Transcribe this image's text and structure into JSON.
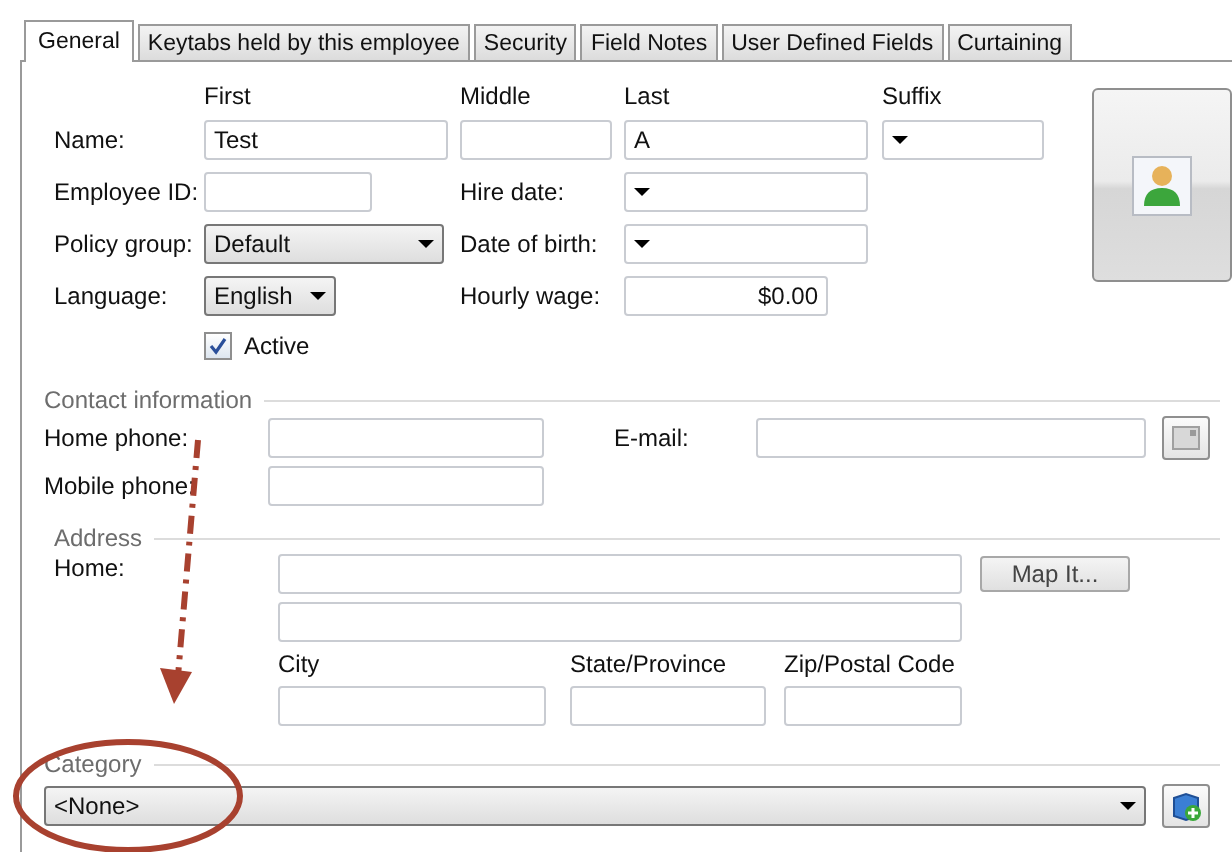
{
  "tabs": [
    {
      "label": "General",
      "selected": true
    },
    {
      "label": "Keytabs held by this employee",
      "selected": false
    },
    {
      "label": "Security",
      "selected": false
    },
    {
      "label": "Field Notes",
      "selected": false
    },
    {
      "label": "User Defined Fields",
      "selected": false
    },
    {
      "label": "Curtaining",
      "selected": false
    }
  ],
  "name_columns": [
    "First",
    "Middle",
    "Last",
    "Suffix"
  ],
  "name": {
    "label": "Name:",
    "first": "Test",
    "last": "A"
  },
  "employee_id_label": "Employee ID:",
  "hire_date_label": "Hire date:",
  "policy_group": {
    "label": "Policy group:",
    "value": "Default"
  },
  "date_of_birth_label": "Date of birth:",
  "language": {
    "label": "Language:",
    "value": "English"
  },
  "hourly_wage": {
    "label": "Hourly wage:",
    "value": "$0.00"
  },
  "active": {
    "label": "Active",
    "checked": true
  },
  "contact": {
    "title": "Contact information",
    "home_phone_label": "Home phone:",
    "mobile_phone_label": "Mobile phone:",
    "email_label": "E-mail:"
  },
  "address": {
    "title": "Address",
    "home_label": "Home:",
    "map_button": "Map It...",
    "city_label": "City",
    "state_label": "State/Province",
    "zip_label": "Zip/Postal Code"
  },
  "category": {
    "title": "Category",
    "value": "<None>"
  }
}
